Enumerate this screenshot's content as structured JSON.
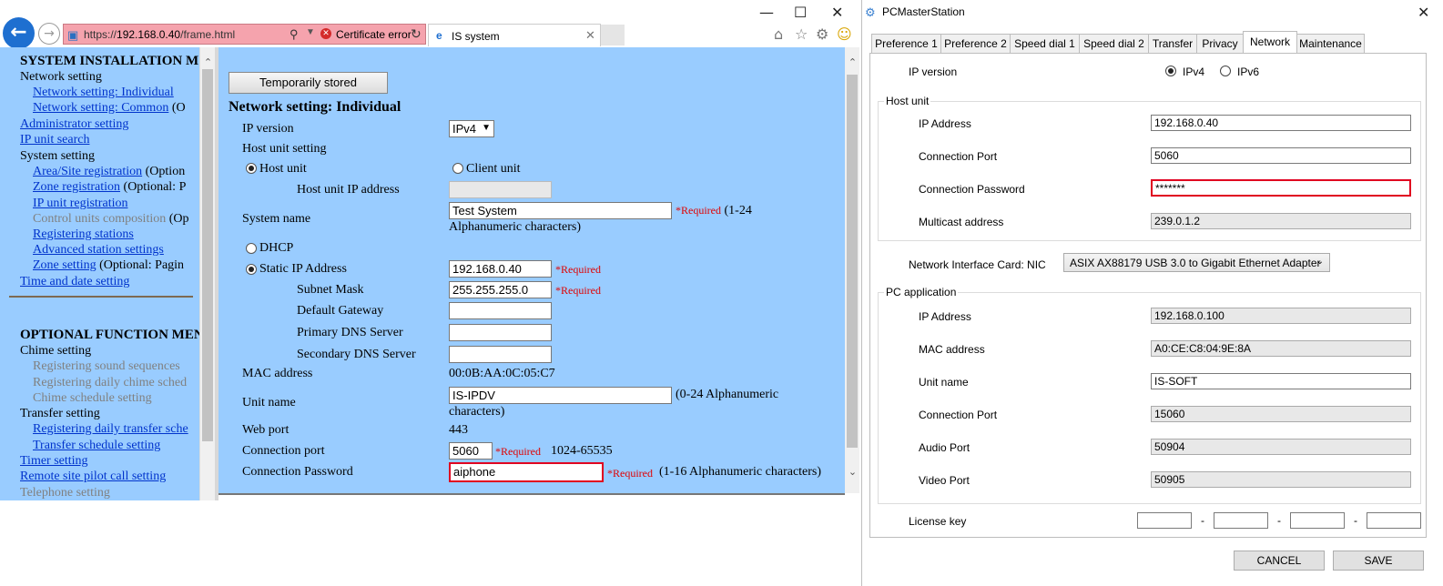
{
  "browser": {
    "url_prefix": "https://",
    "url_host": "192.168.0.40",
    "url_path": "/frame.html",
    "cert_error": "Certificate error",
    "tab_title": "IS system",
    "nav": {
      "sys_header": "SYSTEM INSTALLATION M",
      "network_setting": "Network setting",
      "net_individual": "Network setting: Individual",
      "net_common": "Network setting: Common",
      "net_common_opt": "(O",
      "admin_setting": "Administrator setting",
      "ip_unit_search": "IP unit search",
      "system_setting": "System setting",
      "area_site": "Area/Site registration",
      "area_site_opt": "(Option",
      "zone_reg": "Zone registration",
      "zone_reg_opt": "(Optional: P",
      "ip_unit_reg": "IP unit registration",
      "control_units": "Control units composition",
      "control_units_opt": "(Op",
      "reg_stations": "Registering stations",
      "adv_station": "Advanced station settings",
      "zone_setting": "Zone setting",
      "zone_setting_opt": "(Optional: Pagin",
      "time_date": "Time and date setting",
      "opt_header": "OPTIONAL FUNCTION MEN",
      "chime_setting": "Chime setting",
      "reg_sound": "Registering sound sequences",
      "reg_daily_chime": "Registering daily chime sched",
      "chime_schedule": "Chime schedule setting",
      "transfer_setting": "Transfer setting",
      "reg_daily_transfer": "Registering daily transfer sche",
      "transfer_schedule": "Transfer schedule setting",
      "timer_setting": "Timer setting",
      "remote_site": "Remote site pilot call setting",
      "telephone_setting": "Telephone setting"
    },
    "form": {
      "temp_stored_btn": "Temporarily stored",
      "heading": "Network setting: Individual",
      "ip_version_label": "IP version",
      "ip_version_value": "IPv4",
      "host_unit_setting": "Host unit setting",
      "host_unit": "Host unit",
      "client_unit": "Client unit",
      "host_unit_ip": "Host unit IP address",
      "system_name_label": "System name",
      "system_name_value": "Test System",
      "required": "*Required",
      "system_name_hint1": "(1-24",
      "system_name_hint2": "Alphanumeric characters)",
      "dhcp": "DHCP",
      "static_ip": "Static IP Address",
      "static_ip_value": "192.168.0.40",
      "subnet_mask": "Subnet Mask",
      "subnet_mask_value": "255.255.255.0",
      "default_gateway": "Default Gateway",
      "primary_dns": "Primary DNS Server",
      "secondary_dns": "Secondary DNS Server",
      "mac_label": "MAC address",
      "mac_value": "00:0B:AA:0C:05:C7",
      "unit_name_label": "Unit name",
      "unit_name_value": "IS-IPDV",
      "unit_name_hint1": "(0-24 Alphanumeric",
      "unit_name_hint2": "characters)",
      "web_port_label": "Web port",
      "web_port_value": "443",
      "conn_port_label": "Connection port",
      "conn_port_value": "5060",
      "conn_port_range": "1024-65535",
      "conn_pw_label": "Connection Password",
      "conn_pw_value": "aiphone",
      "conn_pw_hint": "(1-16 Alphanumeric characters)"
    }
  },
  "pcm": {
    "title": "PCMasterStation",
    "tabs": [
      "Preference 1",
      "Preference 2",
      "Speed dial 1",
      "Speed dial 2",
      "Transfer",
      "Privacy",
      "Network",
      "Maintenance"
    ],
    "active_tab": "Network",
    "ip_version_label": "IP version",
    "ipv4": "IPv4",
    "ipv6": "IPv6",
    "host_unit_group": "Host unit",
    "host_ip_label": "IP Address",
    "host_ip_value": "192.168.0.40",
    "host_port_label": "Connection Port",
    "host_port_value": "5060",
    "host_pw_label": "Connection Password",
    "host_pw_value": "*******",
    "multicast_label": "Multicast address",
    "multicast_value": "239.0.1.2",
    "nic_label": "Network Interface Card: NIC",
    "nic_value": "ASIX AX88179 USB 3.0 to Gigabit Ethernet Adapter",
    "pc_app_group": "PC application",
    "pc_ip_label": "IP Address",
    "pc_ip_value": "192.168.0.100",
    "mac_label": "MAC address",
    "mac_value": "A0:CE:C8:04:9E:8A",
    "unit_name_label": "Unit name",
    "unit_name_value": "IS-SOFT",
    "pc_port_label": "Connection Port",
    "pc_port_value": "15060",
    "audio_label": "Audio Port",
    "audio_value": "50904",
    "video_label": "Video Port",
    "video_value": "50905",
    "license_label": "License key",
    "license_sep": "-",
    "cancel": "CANCEL",
    "save": "SAVE"
  }
}
